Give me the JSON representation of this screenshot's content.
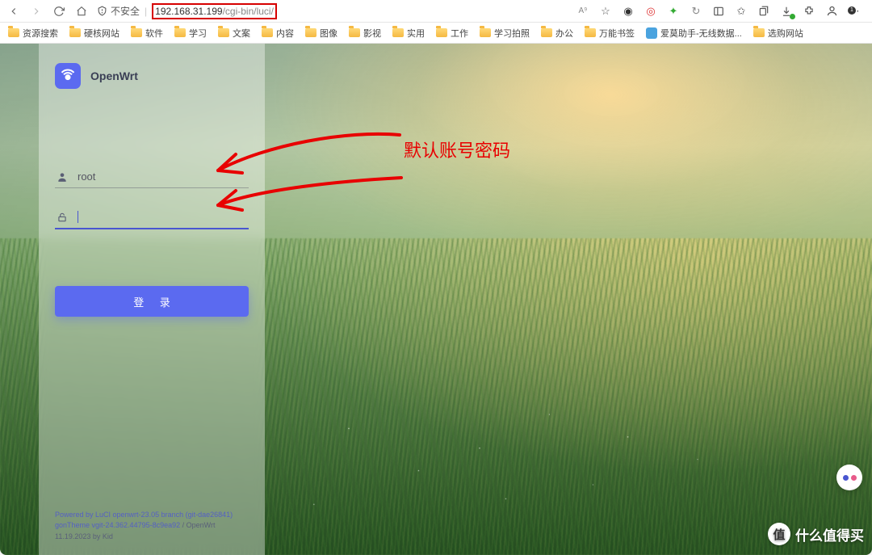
{
  "browser": {
    "security_label": "不安全",
    "url_host": "192.168.31.199",
    "url_path": "/cgi-bin/luci/",
    "badge_count": "1",
    "ai_label": "A⁹"
  },
  "bookmarks": [
    {
      "label": "资源搜索",
      "type": "folder"
    },
    {
      "label": "硬核网站",
      "type": "folder"
    },
    {
      "label": "软件",
      "type": "folder"
    },
    {
      "label": "学习",
      "type": "folder"
    },
    {
      "label": "文案",
      "type": "folder"
    },
    {
      "label": "内容",
      "type": "folder"
    },
    {
      "label": "图像",
      "type": "folder"
    },
    {
      "label": "影视",
      "type": "folder"
    },
    {
      "label": "实用",
      "type": "folder"
    },
    {
      "label": "工作",
      "type": "folder"
    },
    {
      "label": "学习拍照",
      "type": "folder"
    },
    {
      "label": "办公",
      "type": "folder"
    },
    {
      "label": "万能书签",
      "type": "folder"
    },
    {
      "label": "爱莫助手-无线数据...",
      "type": "fav"
    },
    {
      "label": "选购网站",
      "type": "folder"
    }
  ],
  "login": {
    "brand": "OpenWrt",
    "username_value": "root",
    "password_value": "",
    "button_label": "登 录"
  },
  "footer": {
    "line1_a": "Powered by LuCI openwrt-23.05 branch (git-dae26841)",
    "line2_a": "gonTheme vgit-24.362.44795-8c9ea92",
    "line2_b": " / OpenWrt 11.19.2023 by Kid"
  },
  "annotation": {
    "text": "默认账号密码"
  },
  "watermark": {
    "badge": "值",
    "text": "什么值得买"
  }
}
